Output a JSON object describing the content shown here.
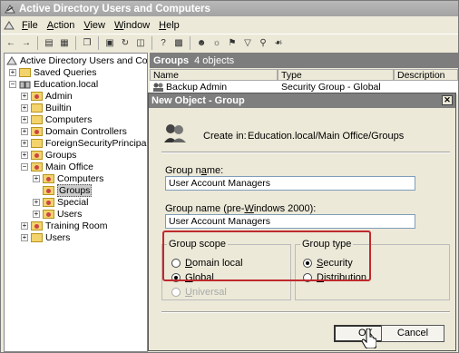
{
  "window": {
    "title": "Active Directory Users and Computers"
  },
  "menu": [
    {
      "label": "File",
      "accel": "F"
    },
    {
      "label": "Action",
      "accel": "A"
    },
    {
      "label": "View",
      "accel": "V"
    },
    {
      "label": "Window",
      "accel": "W"
    },
    {
      "label": "Help",
      "accel": "H"
    }
  ],
  "tree": {
    "root": "Active Directory Users and Computer",
    "saved_queries": "Saved Queries",
    "domain": "Education.local",
    "admin": "Admin",
    "builtin": "Builtin",
    "computers": "Computers",
    "domain_controllers": "Domain Controllers",
    "foreign": "ForeignSecurityPrincipals",
    "groups": "Groups",
    "main_office": "Main Office",
    "mo_computers": "Computers",
    "mo_groups": "Groups",
    "mo_special": "Special",
    "mo_users": "Users",
    "training_room": "Training Room",
    "users": "Users"
  },
  "right_pane": {
    "title": "Groups",
    "count": "4 objects",
    "columns": [
      "Name",
      "Type",
      "Description"
    ],
    "rows": [
      {
        "name": "Backup Admin",
        "type": "Security Group - Global"
      }
    ]
  },
  "dialog": {
    "title": "New Object - Group",
    "create_in_label": "Create in:",
    "create_in_path": "Education.local/Main Office/Groups",
    "group_name_label": "Group name:",
    "group_name_value": "User Account Managers",
    "group_name_pre2000_label": "Group name (pre-Windows 2000):",
    "group_name_pre2000_value": "User Account Managers",
    "scope_legend": "Group scope",
    "scope_options": [
      "Domain local",
      "Global",
      "Universal"
    ],
    "type_legend": "Group type",
    "type_options": [
      "Security",
      "Distribution"
    ],
    "ok": "OK",
    "cancel": "Cancel"
  }
}
